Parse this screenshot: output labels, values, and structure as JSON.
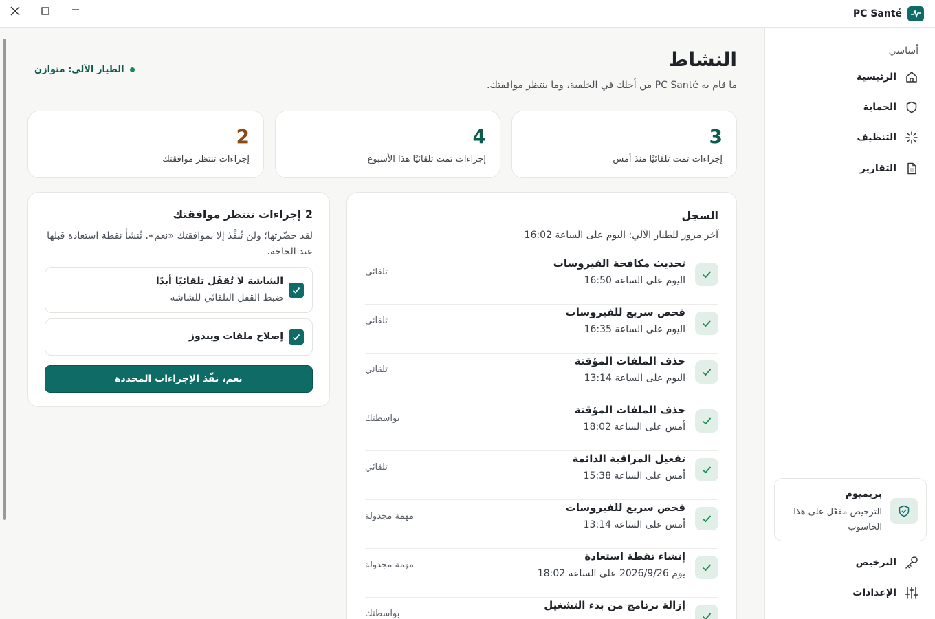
{
  "app": {
    "name": "PC Santé"
  },
  "sidebar": {
    "section_label": "أساسي",
    "items": [
      {
        "label": "الرئيسية",
        "icon": "home-icon"
      },
      {
        "label": "الحماية",
        "icon": "shield-icon"
      },
      {
        "label": "التنظيف",
        "icon": "sparkle-icon"
      },
      {
        "label": "التقارير",
        "icon": "document-icon"
      }
    ],
    "premium": {
      "title": "بريميوم",
      "subtitle": "الترخيص مفعّل على هذا الحاسوب",
      "icon": "shield-check-icon"
    },
    "bottom_items": [
      {
        "label": "الترخيص",
        "icon": "key-icon"
      },
      {
        "label": "الإعدادات",
        "icon": "sliders-icon"
      }
    ]
  },
  "main": {
    "title": "النشاط",
    "subtitle": "ما قام به PC Santé من أجلك في الخلفية، وما ينتظر موافقتك.",
    "autopilot_status": "الطيار الآلي: متوازن",
    "stats": [
      {
        "value": "3",
        "label": "إجراءات تمت تلقائيًا منذ أمس",
        "color": "#0f5a4f"
      },
      {
        "value": "4",
        "label": "إجراءات تمت تلقائيًا هذا الأسبوع",
        "color": "#0f5a4f"
      },
      {
        "value": "2",
        "label": "إجراءات تنتظر موافقتك",
        "color": "#8a4a12"
      }
    ],
    "log": {
      "title": "السجل",
      "subtitle": "آخر مرور للطيار الآلي: اليوم على الساعة 16:02",
      "rows": [
        {
          "title": "تحديث مكافحة الفيروسات",
          "time": "اليوم على الساعة 16:50",
          "source": "تلقائي"
        },
        {
          "title": "فحص سريع للفيروسات",
          "time": "اليوم على الساعة 16:35",
          "source": "تلقائي"
        },
        {
          "title": "حذف الملفات المؤقتة",
          "time": "اليوم على الساعة 13:14",
          "source": "تلقائي"
        },
        {
          "title": "حذف الملفات المؤقتة",
          "time": "أمس على الساعة 18:02",
          "source": "بواسطتك"
        },
        {
          "title": "تفعيل المراقبة الدائمة",
          "time": "أمس على الساعة 15:38",
          "source": "تلقائي"
        },
        {
          "title": "فحص سريع للفيروسات",
          "time": "أمس على الساعة 13:14",
          "source": "مهمة مجدولة"
        },
        {
          "title": "إنشاء نقطة استعادة",
          "time": "يوم 2026/9/26 على الساعة 18:02",
          "source": "مهمة مجدولة"
        },
        {
          "title": "إزالة برنامج من بدء التشغيل",
          "time": "",
          "source": "بواسطتك"
        }
      ]
    },
    "pending": {
      "title": "2 إجراءات تنتظر موافقتك",
      "description": "لقد حضّرتها؛ ولن تُنفَّذ إلا بموافقتك «نعم». تُنشأ نقطة استعادة قبلها عند الحاجة.",
      "items": [
        {
          "title": "الشاشة لا تُقفَل تلقائيًا أبدًا",
          "subtitle": "ضبط القفل التلقائي للشاشة",
          "checked": true
        },
        {
          "title": "إصلاح ملفات ويندوز",
          "subtitle": "",
          "checked": true
        }
      ],
      "confirm_label": "نعم، نفّذ الإجراءات المحددة"
    }
  }
}
